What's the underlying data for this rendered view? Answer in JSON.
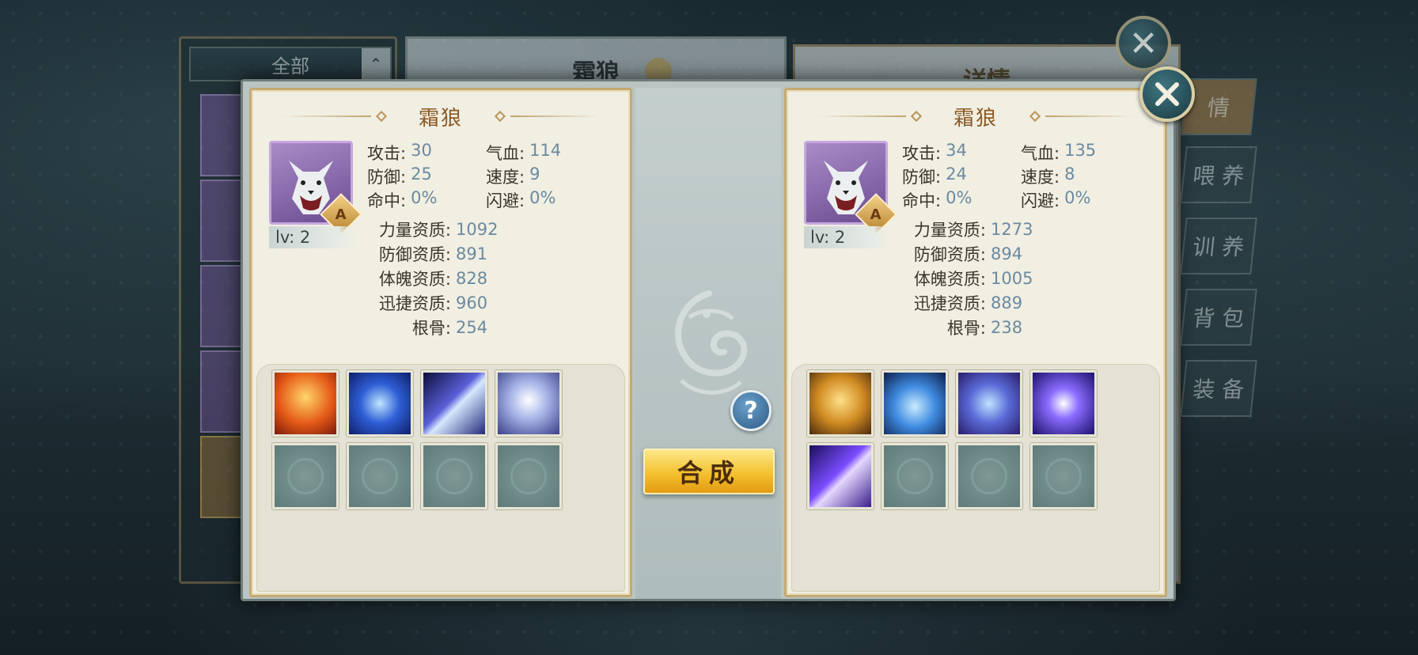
{
  "background_window": {
    "filter_label": "全部",
    "pet_name": "霜狼",
    "details_title": "详情",
    "tabs": [
      "情",
      "喂 养",
      "训 养",
      "背 包",
      "装 备"
    ],
    "partial_text": [
      "根骨",
      "5"
    ]
  },
  "left_pet": {
    "name": "霜狼",
    "grade": "A",
    "level": "lv: 2",
    "stats": [
      {
        "label": "攻击:",
        "value": "30",
        "label2": "气血:",
        "value2": "114"
      },
      {
        "label": "防御:",
        "value": "25",
        "label2": "速度:",
        "value2": "9"
      },
      {
        "label": "命中:",
        "value": "0%",
        "label2": "闪避:",
        "value2": "0%"
      }
    ],
    "aptitudes": [
      {
        "label": "力量资质:",
        "value": "1092"
      },
      {
        "label": "防御资质:",
        "value": "891"
      },
      {
        "label": "体魄资质:",
        "value": "828"
      },
      {
        "label": "迅捷资质:",
        "value": "960"
      },
      {
        "label": "根骨:",
        "value": "254"
      }
    ],
    "skills": [
      "fire-claw-icon",
      "blue-vortex-icon",
      "triple-slash-icon",
      "white-orb-icon",
      "empty",
      "empty",
      "empty",
      "empty"
    ]
  },
  "right_pet": {
    "name": "霜狼",
    "grade": "A",
    "level": "lv: 2",
    "stats": [
      {
        "label": "攻击:",
        "value": "34",
        "label2": "气血:",
        "value2": "135"
      },
      {
        "label": "防御:",
        "value": "24",
        "label2": "速度:",
        "value2": "8"
      },
      {
        "label": "命中:",
        "value": "0%",
        "label2": "闪避:",
        "value2": "0%"
      }
    ],
    "aptitudes": [
      {
        "label": "力量资质:",
        "value": "1273"
      },
      {
        "label": "防御资质:",
        "value": "894"
      },
      {
        "label": "体魄资质:",
        "value": "1005"
      },
      {
        "label": "迅捷资质:",
        "value": "889"
      },
      {
        "label": "根骨:",
        "value": "238"
      }
    ],
    "skills": [
      "roaring-lion-icon",
      "blue-heart-icon",
      "shield-icon",
      "lightning-orb-icon",
      "purple-ribbon-icon",
      "empty",
      "empty",
      "empty"
    ]
  },
  "actions": {
    "compose_label": "合成",
    "help_label": "?"
  },
  "colors": {
    "panel_bg": "#f1eee2",
    "gold_border": "#c4aa72",
    "value_blue": "#6a8aa0",
    "compose_gold": "#f4c12f",
    "avatar_purple": "#8b6ab0"
  }
}
